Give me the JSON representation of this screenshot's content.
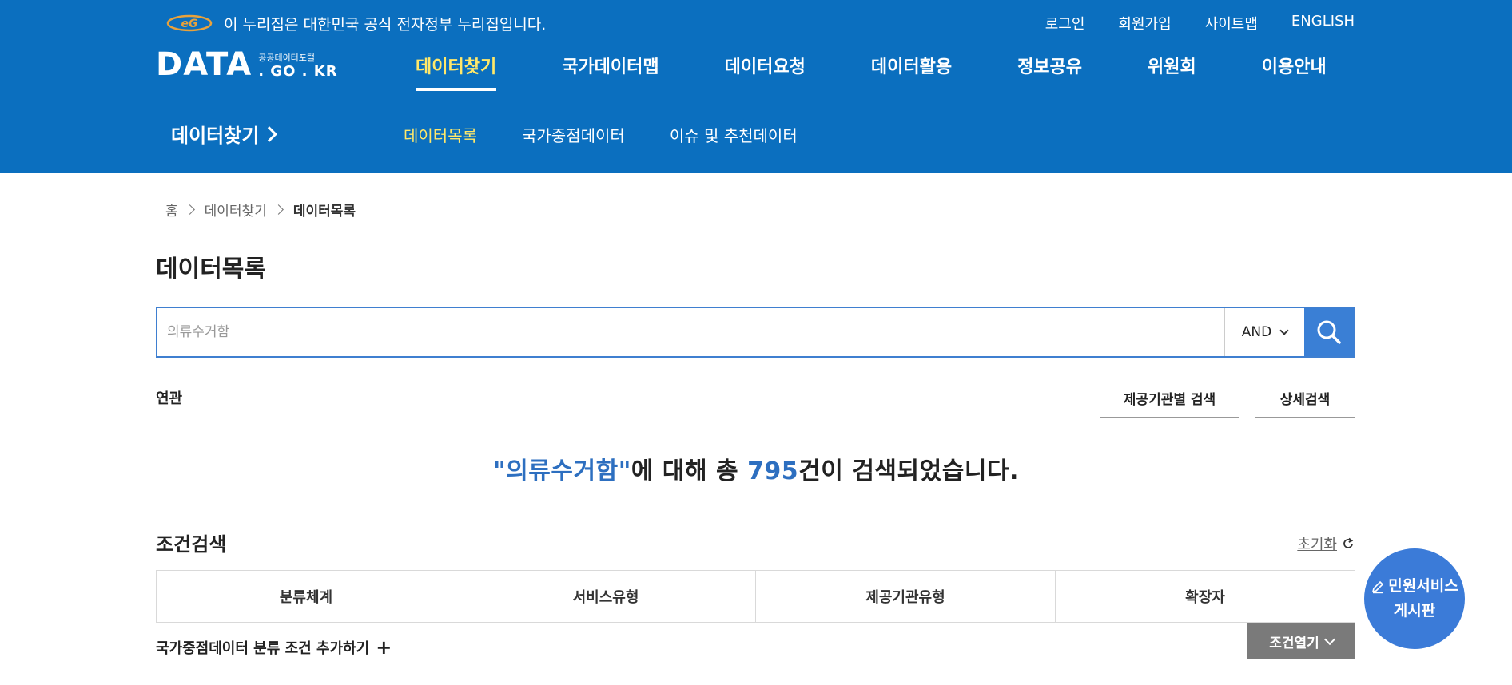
{
  "header": {
    "gov_banner": "이 누리집은 대한민국 공식 전자정부 누리집입니다.",
    "util_links": [
      "로그인",
      "회원가입",
      "사이트맵",
      "ENGLISH"
    ],
    "logo": {
      "main": "DATA",
      "sub_small": "공공데이터포털",
      "sub_large": ". GO . KR"
    },
    "gnb": [
      "데이터찾기",
      "국가데이터맵",
      "데이터요청",
      "데이터활용",
      "정보공유",
      "위원회",
      "이용안내"
    ],
    "lnb_title": "데이터찾기",
    "lnb": [
      "데이터목록",
      "국가중점데이터",
      "이슈 및 추천데이터"
    ]
  },
  "breadcrumb": [
    "홈",
    "데이터찾기",
    "데이터목록"
  ],
  "page_title": "데이터목록",
  "search": {
    "placeholder": "의류수거함",
    "operator": "AND"
  },
  "related_label": "연관",
  "buttons": {
    "org_search": "제공기관별 검색",
    "detail_search": "상세검색"
  },
  "result": {
    "prefix_quote": "\"의류수거함\"",
    "mid": "에 대해 총 ",
    "count": "795",
    "suffix": "건이 검색되었습니다."
  },
  "conditions": {
    "title": "조건검색",
    "reset": "초기화",
    "tabs": [
      "분류체계",
      "서비스유형",
      "제공기관유형",
      "확장자"
    ],
    "add_national": "국가중점데이터 분류 조건 추가하기",
    "open": "조건열기"
  },
  "floating": {
    "line1": "민원서비스",
    "line2": "게시판"
  },
  "colors": {
    "header_bg": "#0b6fbf",
    "active_menu": "#ffe86a",
    "accent": "#2d6fc0"
  }
}
